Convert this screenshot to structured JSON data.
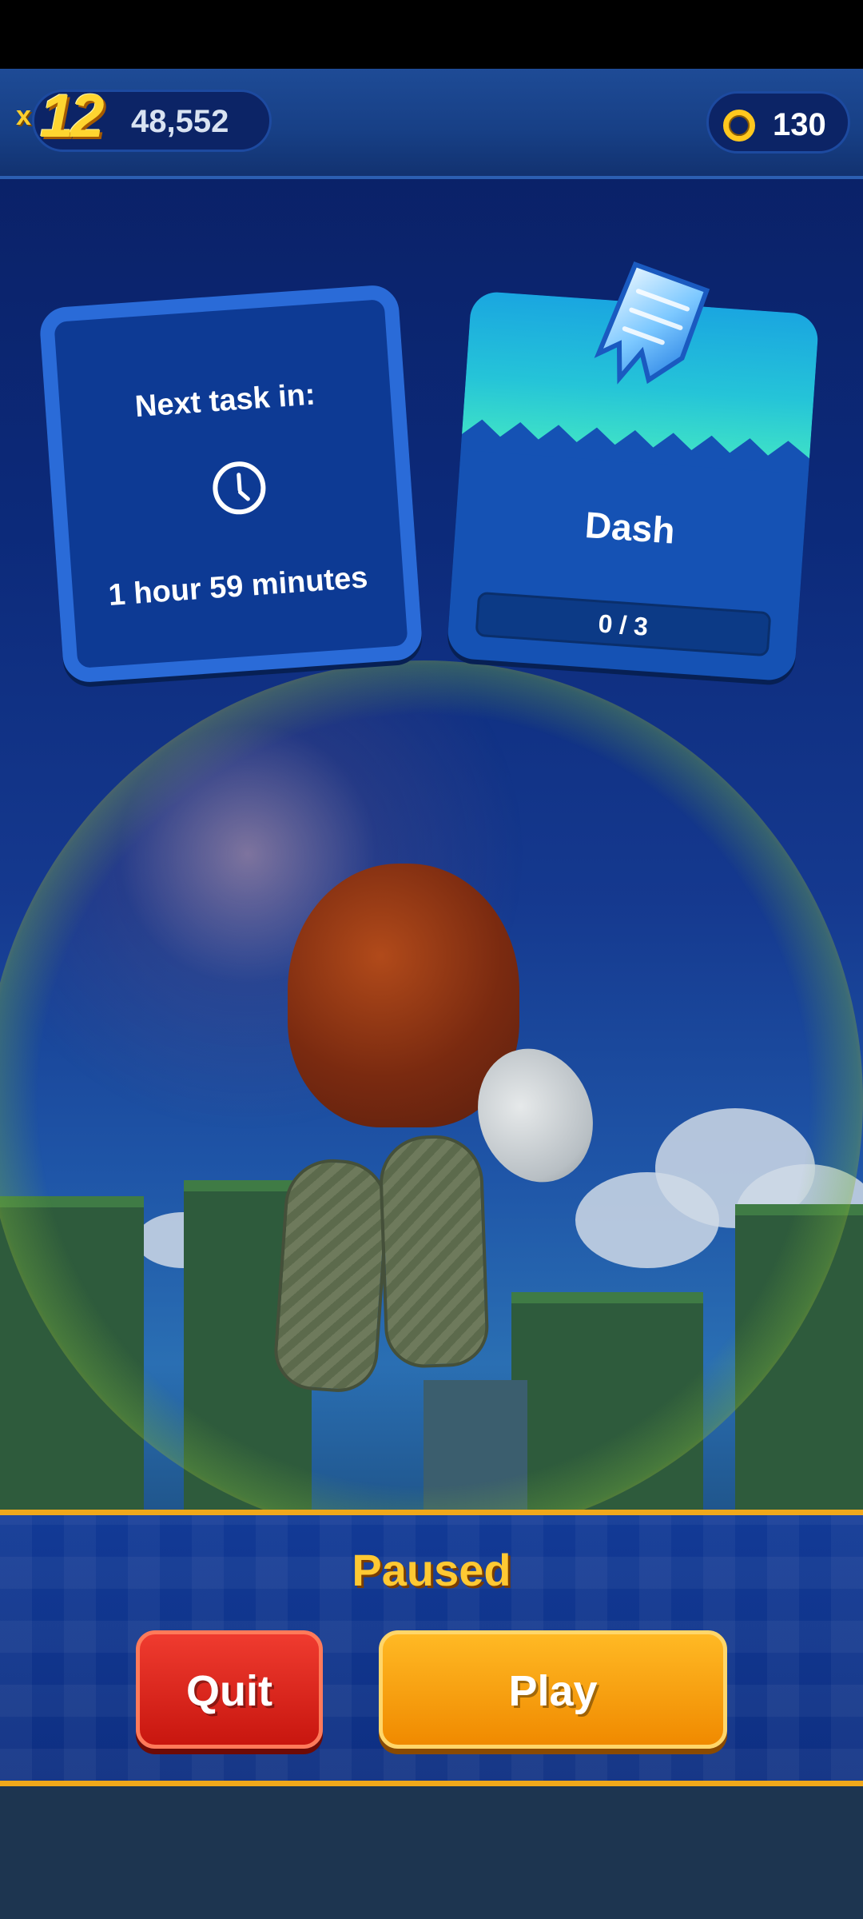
{
  "hud": {
    "multiplier_prefix": "x",
    "multiplier": "12",
    "score": "48,552",
    "rings": "130",
    "ring_icon": "ring-icon"
  },
  "tasks": {
    "next": {
      "title": "Next task in:",
      "time": "1 hour 59 minutes",
      "icon": "clock-icon"
    },
    "current": {
      "name": "Dash",
      "progress_text": "0 / 3",
      "progress_fraction": 0,
      "icon": "dash-crystal-icon"
    }
  },
  "pause_menu": {
    "title": "Paused",
    "quit_label": "Quit",
    "play_label": "Play"
  },
  "colors": {
    "accent_gold": "#f0a81a",
    "quit_red": "#c8160f",
    "play_orange": "#f08a00",
    "panel_blue": "#0e2f82"
  }
}
